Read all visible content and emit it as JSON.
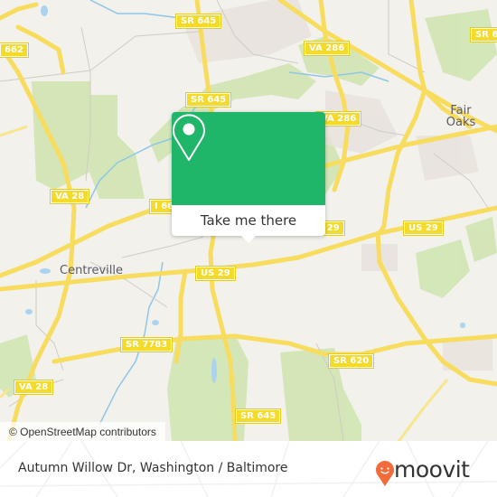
{
  "map": {
    "road_shields": [
      {
        "label": "SR 645"
      },
      {
        "label": "VA 286"
      },
      {
        "label": "SR 6"
      },
      {
        "label": "662"
      },
      {
        "label": "SR 645"
      },
      {
        "label": "VA 286"
      },
      {
        "label": "VA 28"
      },
      {
        "label": "I 66"
      },
      {
        "label": "US 29"
      },
      {
        "label": "US 29"
      },
      {
        "label": "US 29"
      },
      {
        "label": "SR 7783"
      },
      {
        "label": "SR 620"
      },
      {
        "label": "VA 28"
      },
      {
        "label": "SR 645"
      }
    ],
    "places": [
      {
        "name": "Fair\nOaks"
      },
      {
        "name": "Centreville"
      }
    ],
    "attribution": "© OpenStreetMap contributors"
  },
  "popup": {
    "icon": "map-pin-icon",
    "button_label": "Take me there",
    "color": "#1fb66a"
  },
  "footer": {
    "location": "Autumn Willow Dr, Washington / Baltimore",
    "brand": "moovit",
    "brand_color": "#f26b3a"
  }
}
